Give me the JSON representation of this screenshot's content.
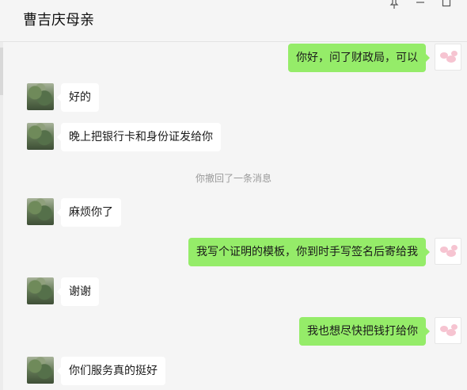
{
  "header": {
    "title": "曹吉庆母亲",
    "pin_icon": "pin-icon",
    "minimize_icon": "minimize-icon",
    "maximize_icon": "maximize-icon"
  },
  "messages": [
    {
      "from": "me",
      "text": "你好，问了财政局，可以"
    },
    {
      "from": "contact",
      "text": "好的"
    },
    {
      "from": "contact",
      "text": "晚上把银行卡和身份证发给你"
    },
    {
      "from": "system",
      "text": "你撤回了一条消息"
    },
    {
      "from": "contact",
      "text": "麻烦你了"
    },
    {
      "from": "me",
      "text": "我写个证明的模板，你到时手写签名后寄给我"
    },
    {
      "from": "contact",
      "text": "谢谢"
    },
    {
      "from": "me",
      "text": "我也想尽快把钱打给你"
    },
    {
      "from": "contact",
      "text": "你们服务真的挺好"
    }
  ],
  "colors": {
    "outgoing_bubble": "#95ec69",
    "incoming_bubble": "#ffffff",
    "background": "#f5f5f5"
  }
}
